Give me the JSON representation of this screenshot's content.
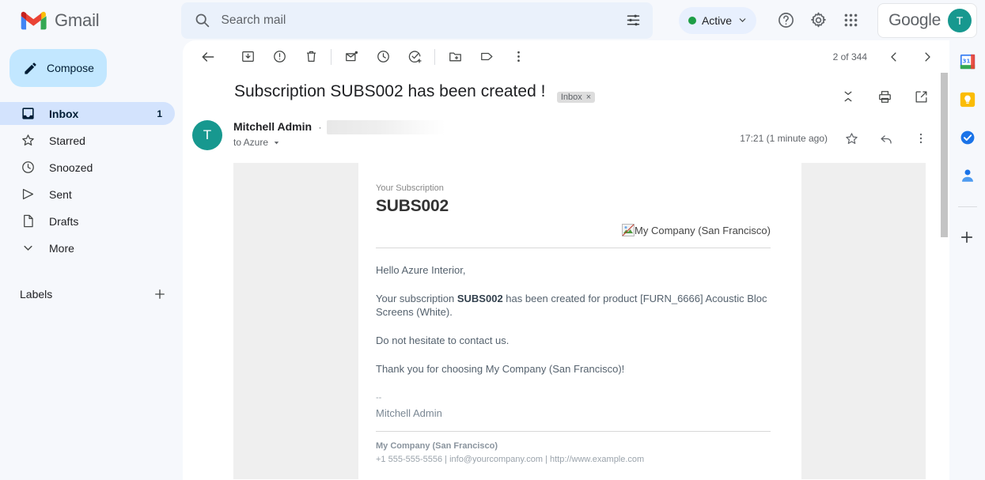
{
  "header": {
    "brand": "Gmail",
    "brand_icon": "gmail-m-logo",
    "search": {
      "placeholder": "Search mail",
      "value": "",
      "icon": "search-icon",
      "options_icon": "search-options-icon"
    },
    "status": {
      "label": "Active",
      "color": "#1e9e46",
      "chevron": "chevron-down-icon"
    },
    "support_icon": "help-icon",
    "settings_icon": "gear-icon",
    "apps_icon": "apps-grid-icon",
    "account": {
      "brand": "Google",
      "avatar_initial": "T",
      "avatar_color": "#17988f"
    }
  },
  "sidebar": {
    "compose": {
      "label": "Compose",
      "icon": "pencil-icon"
    },
    "items": [
      {
        "label": "Inbox",
        "icon": "inbox-icon",
        "count": "1",
        "selected": true
      },
      {
        "label": "Starred",
        "icon": "star-icon",
        "count": "",
        "selected": false
      },
      {
        "label": "Snoozed",
        "icon": "clock-icon",
        "count": "",
        "selected": false
      },
      {
        "label": "Sent",
        "icon": "send-icon",
        "count": "",
        "selected": false
      },
      {
        "label": "Drafts",
        "icon": "draft-icon",
        "count": "",
        "selected": false
      },
      {
        "label": "More",
        "icon": "chevron-down-icon",
        "count": "",
        "selected": false
      }
    ],
    "labels": {
      "title": "Labels",
      "add_icon": "plus-icon"
    }
  },
  "toolbar": {
    "back_icon": "back-arrow-icon",
    "archive_icon": "archive-icon",
    "spam_icon": "report-spam-icon",
    "delete_icon": "trash-icon",
    "unread_icon": "mark-unread-icon",
    "snooze_icon": "snooze-clock-icon",
    "tasks_icon": "add-to-tasks-icon",
    "move_icon": "move-to-folder-icon",
    "label_icon": "label-tag-icon",
    "more_icon": "more-vertical-icon",
    "pagination": "2 of 344",
    "prev_icon": "chevron-left-icon",
    "next_icon": "chevron-right-icon"
  },
  "email": {
    "subject": "Subscription SUBS002 has been created !",
    "chip_label": "Inbox",
    "chip_close": "×",
    "collapse_icon": "collapse-all-icon",
    "print_icon": "print-icon",
    "popout_icon": "open-in-new-window-icon",
    "sender_name": "Mitchell Admin",
    "sender_separator": "·",
    "sender_address_redacted": true,
    "avatar_initial": "T",
    "to_line": "to Azure",
    "to_chevron": "chevron-down-icon",
    "timestamp": "17:21 (1 minute ago)",
    "star_icon": "star-icon",
    "reply_icon": "reply-icon",
    "more_icon": "more-vertical-icon"
  },
  "body": {
    "your_subscription_label": "Your Subscription",
    "subscription_code": "SUBS002",
    "company_image_alt": "My Company (San Francisco)",
    "broken_image_icon": "broken-image-icon",
    "greeting": "Hello Azure Interior,",
    "line_prefix": "Your subscription ",
    "line_code": "SUBS002",
    "line_suffix": " has been created for product [FURN_6666] Acoustic Bloc Screens (White).",
    "contact_line": "Do not hesitate to contact us.",
    "thanks_line": "Thank you for choosing My Company (San Francisco)!",
    "signature_dashes": "--",
    "signature_name": "Mitchell Admin",
    "footer_company": "My Company (San Francisco)",
    "footer_contact": "+1 555-555-5556 | info@yourcompany.com | http://www.example.com"
  },
  "rightrail": {
    "items": [
      {
        "icon": "google-calendar-icon",
        "label": "Calendar"
      },
      {
        "icon": "google-keep-icon",
        "label": "Keep"
      },
      {
        "icon": "google-tasks-icon",
        "label": "Tasks"
      },
      {
        "icon": "google-contacts-icon",
        "label": "Contacts"
      }
    ],
    "add_icon": "plus-icon"
  }
}
